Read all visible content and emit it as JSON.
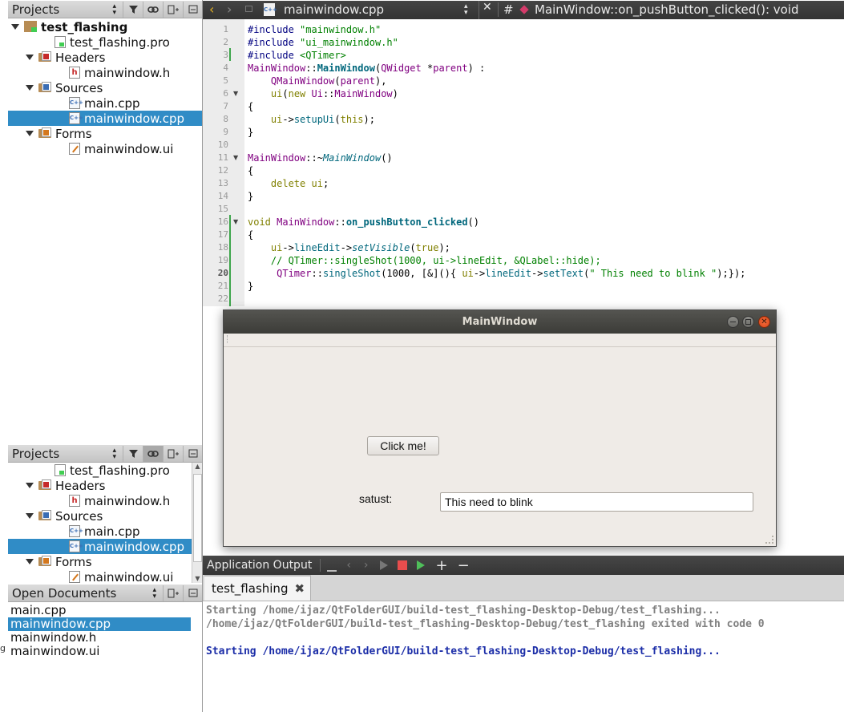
{
  "projects_top": {
    "header": "Projects",
    "items": [
      {
        "label": "test_flashing",
        "kind": "project",
        "level": 0,
        "selected": false
      },
      {
        "label": "test_flashing.pro",
        "kind": "pro",
        "level": 1,
        "selected": false
      },
      {
        "label": "Headers",
        "kind": "folder-h",
        "level": 1,
        "selected": false
      },
      {
        "label": "mainwindow.h",
        "kind": "h",
        "level": 2,
        "selected": false
      },
      {
        "label": "Sources",
        "kind": "folder-cpp",
        "level": 1,
        "selected": false
      },
      {
        "label": "main.cpp",
        "kind": "cpp",
        "level": 2,
        "selected": false
      },
      {
        "label": "mainwindow.cpp",
        "kind": "cpp",
        "level": 2,
        "selected": true
      },
      {
        "label": "Forms",
        "kind": "folder-ui",
        "level": 1,
        "selected": false
      },
      {
        "label": "mainwindow.ui",
        "kind": "ui",
        "level": 2,
        "selected": false
      }
    ]
  },
  "projects_bottom": {
    "header": "Projects",
    "items": [
      {
        "label": "test_flashing.pro",
        "kind": "pro",
        "level": 1,
        "selected": false
      },
      {
        "label": "Headers",
        "kind": "folder-h",
        "level": 1,
        "selected": false
      },
      {
        "label": "mainwindow.h",
        "kind": "h",
        "level": 2,
        "selected": false
      },
      {
        "label": "Sources",
        "kind": "folder-cpp",
        "level": 1,
        "selected": false
      },
      {
        "label": "main.cpp",
        "kind": "cpp",
        "level": 2,
        "selected": false
      },
      {
        "label": "mainwindow.cpp",
        "kind": "cpp",
        "level": 2,
        "selected": true
      },
      {
        "label": "Forms",
        "kind": "folder-ui",
        "level": 1,
        "selected": false
      },
      {
        "label": "mainwindow.ui",
        "kind": "ui",
        "level": 2,
        "selected": false
      }
    ]
  },
  "open_documents": {
    "header": "Open Documents",
    "items": [
      {
        "label": "main.cpp",
        "selected": false
      },
      {
        "label": "mainwindow.cpp",
        "selected": true
      },
      {
        "label": "mainwindow.h",
        "selected": false
      },
      {
        "label": "mainwindow.ui",
        "selected": false
      }
    ]
  },
  "editor_toolbar": {
    "file_name": "mainwindow.cpp",
    "hash_symbol": "#",
    "symbol": "MainWindow::on_pushButton_clicked(): void"
  },
  "code_lines": [
    [
      [
        "#include ",
        "pp"
      ],
      [
        "\"mainwindow.h\"",
        "str"
      ]
    ],
    [
      [
        "#include ",
        "pp"
      ],
      [
        "\"ui_mainwindow.h\"",
        "str"
      ]
    ],
    [
      [
        "#include ",
        "pp"
      ],
      [
        "<QTimer>",
        "str"
      ]
    ],
    [
      [
        "MainWindow",
        "cls"
      ],
      [
        "::",
        ""
      ],
      [
        "MainWindow",
        "fnb"
      ],
      [
        "(",
        ""
      ],
      [
        "QWidget",
        "cls"
      ],
      [
        " *",
        ""
      ],
      [
        "parent",
        "cls"
      ],
      [
        ") :",
        ""
      ]
    ],
    [
      [
        "    ",
        ""
      ],
      [
        "QMainWindow",
        "cls"
      ],
      [
        "(",
        ""
      ],
      [
        "parent",
        "cls"
      ],
      [
        "),",
        ""
      ]
    ],
    [
      [
        "    ",
        ""
      ],
      [
        "ui",
        "kw"
      ],
      [
        "(",
        ""
      ],
      [
        "new ",
        "kw"
      ],
      [
        "Ui",
        "cls"
      ],
      [
        "::",
        ""
      ],
      [
        "MainWindow",
        "cls"
      ],
      [
        ")",
        ""
      ]
    ],
    [
      [
        "{",
        ""
      ]
    ],
    [
      [
        "    ",
        ""
      ],
      [
        "ui",
        "kw"
      ],
      [
        "->",
        ""
      ],
      [
        "setupUi",
        "fn"
      ],
      [
        "(",
        ""
      ],
      [
        "this",
        "kw"
      ],
      [
        ");",
        ""
      ]
    ],
    [
      [
        "}",
        ""
      ]
    ],
    [
      [
        "",
        ""
      ]
    ],
    [
      [
        "MainWindow",
        "cls"
      ],
      [
        "::~",
        ""
      ],
      [
        "MainWindow",
        "it"
      ],
      [
        "()",
        ""
      ]
    ],
    [
      [
        "{",
        ""
      ]
    ],
    [
      [
        "    ",
        ""
      ],
      [
        "delete ",
        "kw"
      ],
      [
        "ui",
        "kw"
      ],
      [
        ";",
        ""
      ]
    ],
    [
      [
        "}",
        ""
      ]
    ],
    [
      [
        "",
        ""
      ]
    ],
    [
      [
        "void ",
        "kw"
      ],
      [
        "MainWindow",
        "cls"
      ],
      [
        "::",
        ""
      ],
      [
        "on_pushButton_clicked",
        "fnb"
      ],
      [
        "()",
        ""
      ]
    ],
    [
      [
        "{",
        ""
      ]
    ],
    [
      [
        "    ",
        ""
      ],
      [
        "ui",
        "kw"
      ],
      [
        "->",
        ""
      ],
      [
        "lineEdit",
        "fn"
      ],
      [
        "->",
        ""
      ],
      [
        "setVisible",
        "it"
      ],
      [
        "(",
        ""
      ],
      [
        "true",
        "kw"
      ],
      [
        ");",
        ""
      ]
    ],
    [
      [
        "    // QTimer::singleShot(1000, ui->lineEdit, &QLabel::hide);",
        "cm"
      ]
    ],
    [
      [
        "     ",
        ""
      ],
      [
        "QTimer",
        "cls"
      ],
      [
        "::",
        ""
      ],
      [
        "singleShot",
        "fn"
      ],
      [
        "(1000, [&](){ ",
        ""
      ],
      [
        "ui",
        "kw"
      ],
      [
        "->",
        ""
      ],
      [
        "lineEdit",
        "fn"
      ],
      [
        "->",
        ""
      ],
      [
        "setText",
        "fn"
      ],
      [
        "(",
        ""
      ],
      [
        "\" This need to blink \"",
        "str"
      ],
      [
        ");});",
        ""
      ]
    ],
    [
      [
        "}",
        ""
      ]
    ],
    [
      [
        "",
        ""
      ]
    ]
  ],
  "line_numbers": [
    "1",
    "2",
    "3",
    "4",
    "5",
    "6",
    "7",
    "8",
    "9",
    "10",
    "11",
    "12",
    "13",
    "14",
    "15",
    "16",
    "17",
    "18",
    "19",
    "20",
    "21",
    "22"
  ],
  "main_window": {
    "title": "MainWindow",
    "button_label": "Click me!",
    "status_label": "satust:",
    "line_edit_value": "This need to blink"
  },
  "output": {
    "title": "Application Output",
    "tab_label": "test_flashing",
    "lines": [
      {
        "text": "Starting /home/ijaz/QtFolderGUI/build-test_flashing-Desktop-Debug/test_flashing...",
        "color": "#7f7f7f"
      },
      {
        "text": "/home/ijaz/QtFolderGUI/build-test_flashing-Desktop-Debug/test_flashing exited with code 0",
        "color": "#7f7f7f"
      },
      {
        "text": "",
        "color": "#7f7f7f"
      },
      {
        "text": "Starting /home/ijaz/QtFolderGUI/build-test_flashing-Desktop-Debug/test_flashing...",
        "color": "#1c2ea8"
      }
    ]
  },
  "colors": {
    "selection": "#308cc6",
    "title_bar": "#3c3c38",
    "close_button": "#e95420"
  }
}
